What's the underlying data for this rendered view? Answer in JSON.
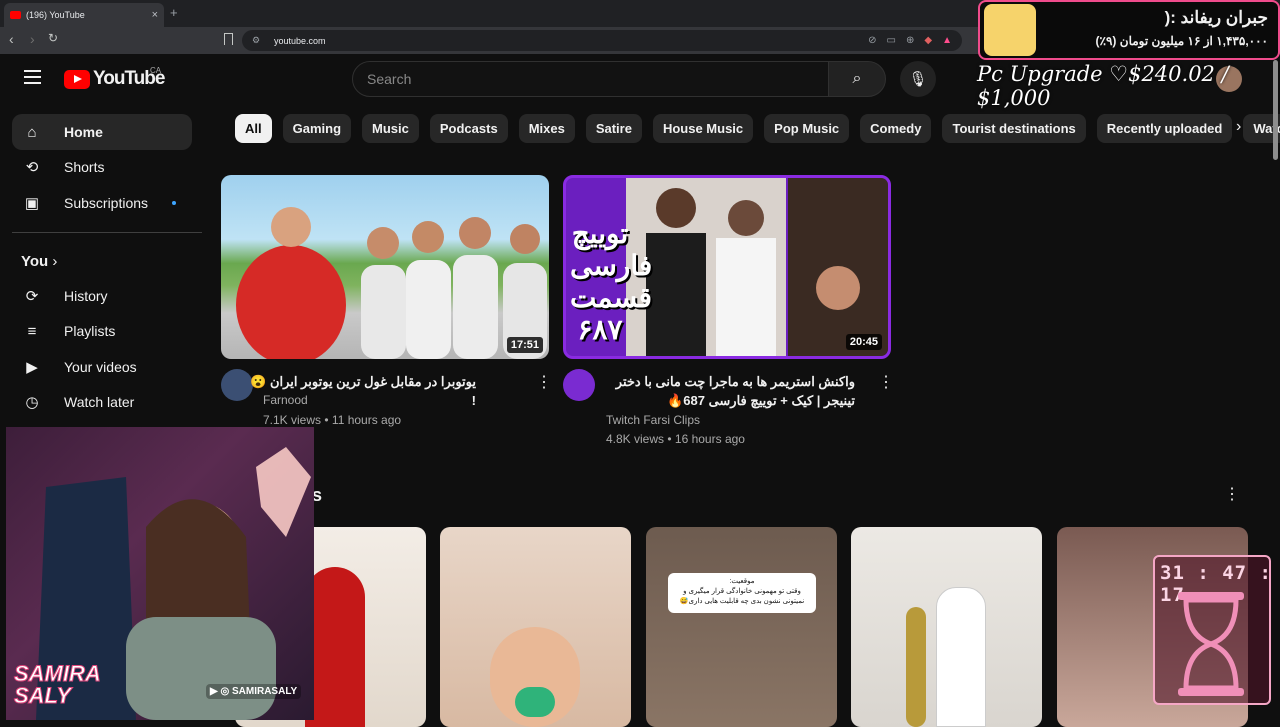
{
  "browser": {
    "tab_title": "(196) YouTube",
    "url": "youtube.com",
    "new_tab": "+",
    "tab_close": "×"
  },
  "masthead": {
    "brand": "YouTube",
    "region": "CA",
    "search_placeholder": "Search"
  },
  "sidebar": {
    "items": [
      {
        "label": "Home",
        "icon": "home-icon"
      },
      {
        "label": "Shorts",
        "icon": "shorts-icon"
      },
      {
        "label": "Subscriptions",
        "icon": "subscriptions-icon"
      }
    ],
    "you_header": "You",
    "you_items": [
      {
        "label": "History",
        "icon": "history-icon"
      },
      {
        "label": "Playlists",
        "icon": "playlists-icon"
      },
      {
        "label": "Your videos",
        "icon": "your-videos-icon"
      },
      {
        "label": "Watch later",
        "icon": "watch-later-icon"
      }
    ]
  },
  "chips": [
    "All",
    "Gaming",
    "Music",
    "Podcasts",
    "Mixes",
    "Satire",
    "House Music",
    "Pop Music",
    "Comedy",
    "Tourist destinations",
    "Recently uploaded",
    "Watch"
  ],
  "videos": [
    {
      "title": "یوتوبرا در مقابل غول ترین یوتوبر ایران 😮 !",
      "channel": "Farnood",
      "views": "7.1K views",
      "age": "11 hours ago",
      "duration": "17:51"
    },
    {
      "title": "واکنش استریمر ها به ماجرا چت مانی با دختر تینیجر | کیک + توییچ فارسی 687🔥",
      "channel": "Twitch Farsi Clips",
      "views": "4.8K views",
      "age": "16 hours ago",
      "duration": "20:45",
      "thumb_text_top": "توییچ",
      "thumb_text_mid": "فارسی",
      "thumb_text_label": "قسمت",
      "thumb_text_num": "۶۸۷"
    }
  ],
  "shorts": {
    "title_fragment": "s",
    "short3_caption": "موقعیت:\nوقتی تو مهمونی خانوادگی قرار میگیری و نمیتونی نشون بدی چه قابلیت هایی داری😅"
  },
  "stream_overlay": {
    "donation_title": "جبران ریفاند :(",
    "donation_sub": "۱,۴۳۵,۰۰۰ از ۱۶ میلیون تومان (۹٪)",
    "goal": "Pc Upgrade ♡$240.02 / $1,000",
    "timer": "31 : 47 : 17",
    "streamer_name_1": "SAMIRA",
    "streamer_name_2": "SALY",
    "social": "SAMIRASALY"
  },
  "colors": {
    "yt_red": "#ff0000",
    "accent_pink": "#f04c8c",
    "bg": "#0f0f0f"
  }
}
